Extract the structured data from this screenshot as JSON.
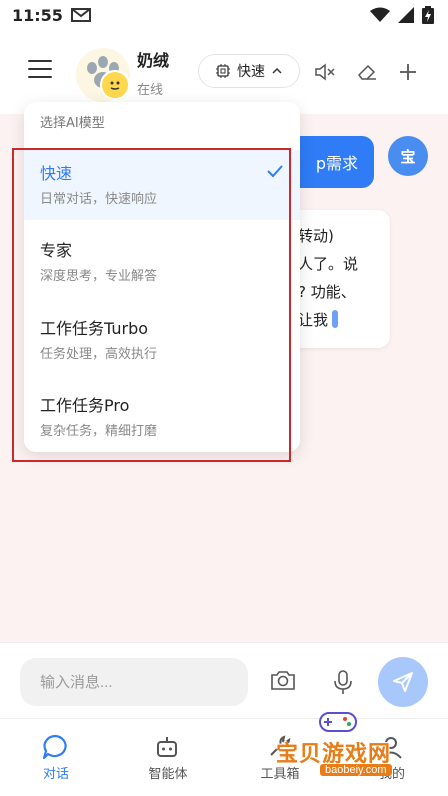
{
  "status_bar": {
    "time": "11:55"
  },
  "header": {
    "bot_name": "奶绒",
    "bot_status": "在线",
    "model_selector_label": "快速"
  },
  "chat": {
    "user_avatar_label": "宝",
    "user_message_partial": "p需求",
    "bot_message_lines": [
      "转动)",
      "人了。说",
      "? 功能、",
      "让我"
    ]
  },
  "model_dropdown": {
    "title": "选择AI模型",
    "options": [
      {
        "name": "快速",
        "desc": "日常对话，快速响应",
        "selected": true
      },
      {
        "name": "专家",
        "desc": "深度思考，专业解答",
        "selected": false
      },
      {
        "name": "工作任务Turbo",
        "desc": "任务处理，高效执行",
        "selected": false
      },
      {
        "name": "工作任务Pro",
        "desc": "复杂任务，精细打磨",
        "selected": false
      }
    ]
  },
  "input_bar": {
    "placeholder": "输入消息..."
  },
  "bottom_nav": {
    "items": [
      {
        "label": "对话",
        "icon": "chat-bubble-icon",
        "active": true
      },
      {
        "label": "智能体",
        "icon": "robot-icon",
        "active": false
      },
      {
        "label": "工具箱",
        "icon": "toolbox-icon",
        "active": false
      },
      {
        "label": "我的",
        "icon": "profile-icon",
        "active": false
      }
    ]
  },
  "watermark": {
    "text": "宝贝游戏网",
    "url": "baobeiy.com"
  },
  "colors": {
    "accent": "#2f7cf6",
    "chat_bg": "#fdf2f2",
    "highlight_box": "#cc2a2a"
  }
}
